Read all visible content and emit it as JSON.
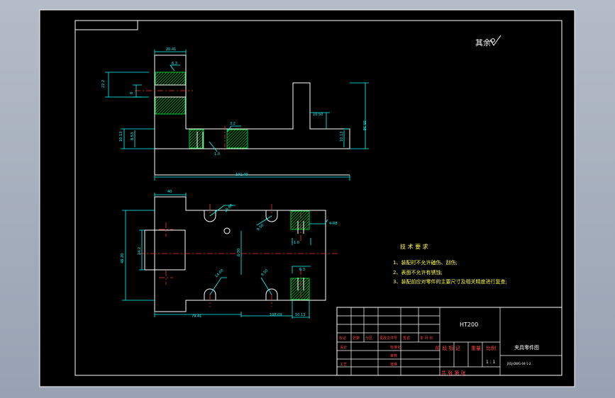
{
  "drawing": {
    "roughness_note": "其余",
    "dimensions": {
      "top_width": "20.41",
      "left_height": "22.2",
      "slot_height": "8",
      "step_height": "10.50",
      "total_height": "35.38",
      "base_left": "10.13",
      "base_inner": "8.53",
      "base_right": "10.13",
      "total_length": "101.40",
      "roughness_a": "6.3",
      "roughness_b": "3.2",
      "label_a": "1.0",
      "plan_top_dim": "40",
      "plan_right_dim": "4-R8",
      "plan_height": "48.20",
      "plan_inner": "24.2",
      "plan_center": "6.30",
      "hole_dim_a": "19.60",
      "hole_dim_b": "9.50",
      "hole_dim_c": "14.00",
      "hole_dim_d": "9.50",
      "bottom_left": "79.41",
      "bottom_mid": "108.09",
      "bottom_right": "10.13",
      "r_label_a": "1.0",
      "r_label_b": "6.3"
    },
    "tech_notes": {
      "title": "技 术 要 求",
      "lines": [
        "1、装配时不允许磕伤、刮伤;",
        "2、表面不允许有锈蚀;",
        "3、装配前应对零件的主要尺寸及相关精度进行复查;"
      ]
    }
  },
  "title_block": {
    "material": "HT200",
    "part_name": "夹具零件图",
    "drawing_no": "JXSJ-DWG-04-1-2",
    "scale_label": "比例",
    "scale_value": "1 : 1",
    "stage_label": "阶 段 标 记",
    "weight_label": "重量",
    "sheet_row": "共    张    第    张",
    "rows": {
      "mark": "标记",
      "count": "处数",
      "zone": "分区",
      "change_doc": "更改文件号",
      "signature": "签名",
      "date": "年 月 日",
      "designer": "设计",
      "standard": "标准化",
      "checker": "审核",
      "process": "工艺",
      "approve": "批准"
    }
  },
  "colors": {
    "sheet": "#000000",
    "outline": "#ffffff",
    "dimension": "#00ffff",
    "hatch": "#00cc33",
    "center": "#ff3333",
    "text_yellow": "#ffff44",
    "text_red": "#ff4444"
  }
}
